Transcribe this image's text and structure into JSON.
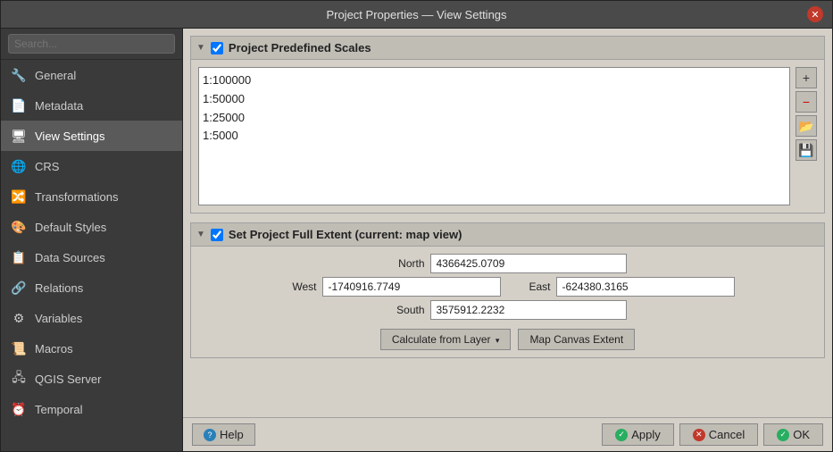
{
  "title": "Project Properties — View Settings",
  "sidebar": {
    "search_placeholder": "Search...",
    "items": [
      {
        "id": "general",
        "label": "General",
        "icon": "🔧"
      },
      {
        "id": "metadata",
        "label": "Metadata",
        "icon": "📄"
      },
      {
        "id": "view-settings",
        "label": "View Settings",
        "icon": "🖥",
        "active": true
      },
      {
        "id": "crs",
        "label": "CRS",
        "icon": "🌐"
      },
      {
        "id": "transformations",
        "label": "Transformations",
        "icon": "🔀"
      },
      {
        "id": "default-styles",
        "label": "Default Styles",
        "icon": "🎨"
      },
      {
        "id": "data-sources",
        "label": "Data Sources",
        "icon": "📋"
      },
      {
        "id": "relations",
        "label": "Relations",
        "icon": "🔗"
      },
      {
        "id": "variables",
        "label": "Variables",
        "icon": "⚙"
      },
      {
        "id": "macros",
        "label": "Macros",
        "icon": "📜"
      },
      {
        "id": "qgis-server",
        "label": "QGIS Server",
        "icon": "🖧"
      },
      {
        "id": "temporal",
        "label": "Temporal",
        "icon": "⏰"
      }
    ]
  },
  "predefined_scales": {
    "section_title": "Project Predefined Scales",
    "scales": [
      "1:100000",
      "1:50000",
      "1:25000",
      "1:5000"
    ],
    "buttons": {
      "add": "+",
      "remove": "−",
      "folder": "📂",
      "save": "💾"
    }
  },
  "full_extent": {
    "section_title": "Set Project Full Extent (current: map view)",
    "north_label": "North",
    "west_label": "West",
    "east_label": "East",
    "south_label": "South",
    "north_value": "4366425.0709",
    "west_value": "-1740916.7749",
    "east_value": "-624380.3165",
    "south_value": "3575912.2232",
    "calc_btn": "Calculate from Layer",
    "map_canvas_btn": "Map Canvas Extent"
  },
  "footer": {
    "help": "Help",
    "apply": "Apply",
    "cancel": "Cancel",
    "ok": "OK"
  }
}
